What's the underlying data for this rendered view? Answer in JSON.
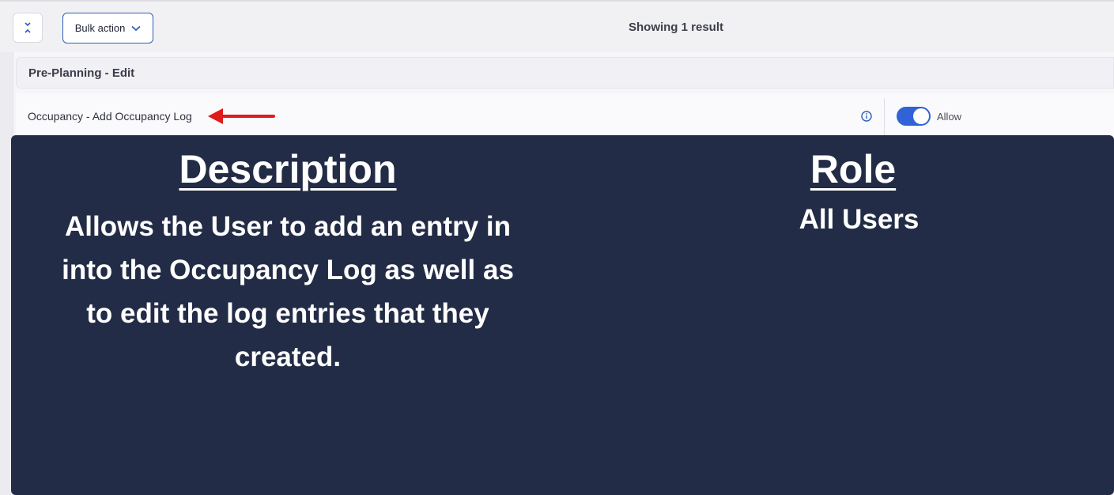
{
  "toolbar": {
    "collapse_icon": "collapse-chevrons-icon",
    "bulk_action_label": "Bulk action",
    "bulk_action_icon": "chevron-down-icon",
    "result_count": "Showing 1 result"
  },
  "section": {
    "title": "Pre-Planning - Edit"
  },
  "permission": {
    "label": "Occupancy - Add Occupancy Log",
    "arrow_icon": "red-arrow-left-icon",
    "info_icon": "info-icon",
    "toggle_on": true,
    "toggle_label": "Allow"
  },
  "overlay": {
    "description_heading": "Description",
    "description_body": "Allows the User to add an entry in into the Occupancy Log as well as to edit the log entries that they created.",
    "role_heading": "Role",
    "role_body": "All Users"
  },
  "colors": {
    "accent": "#2f63d6",
    "overlay_bg": "#232c46",
    "arrow": "#e01b1b"
  }
}
